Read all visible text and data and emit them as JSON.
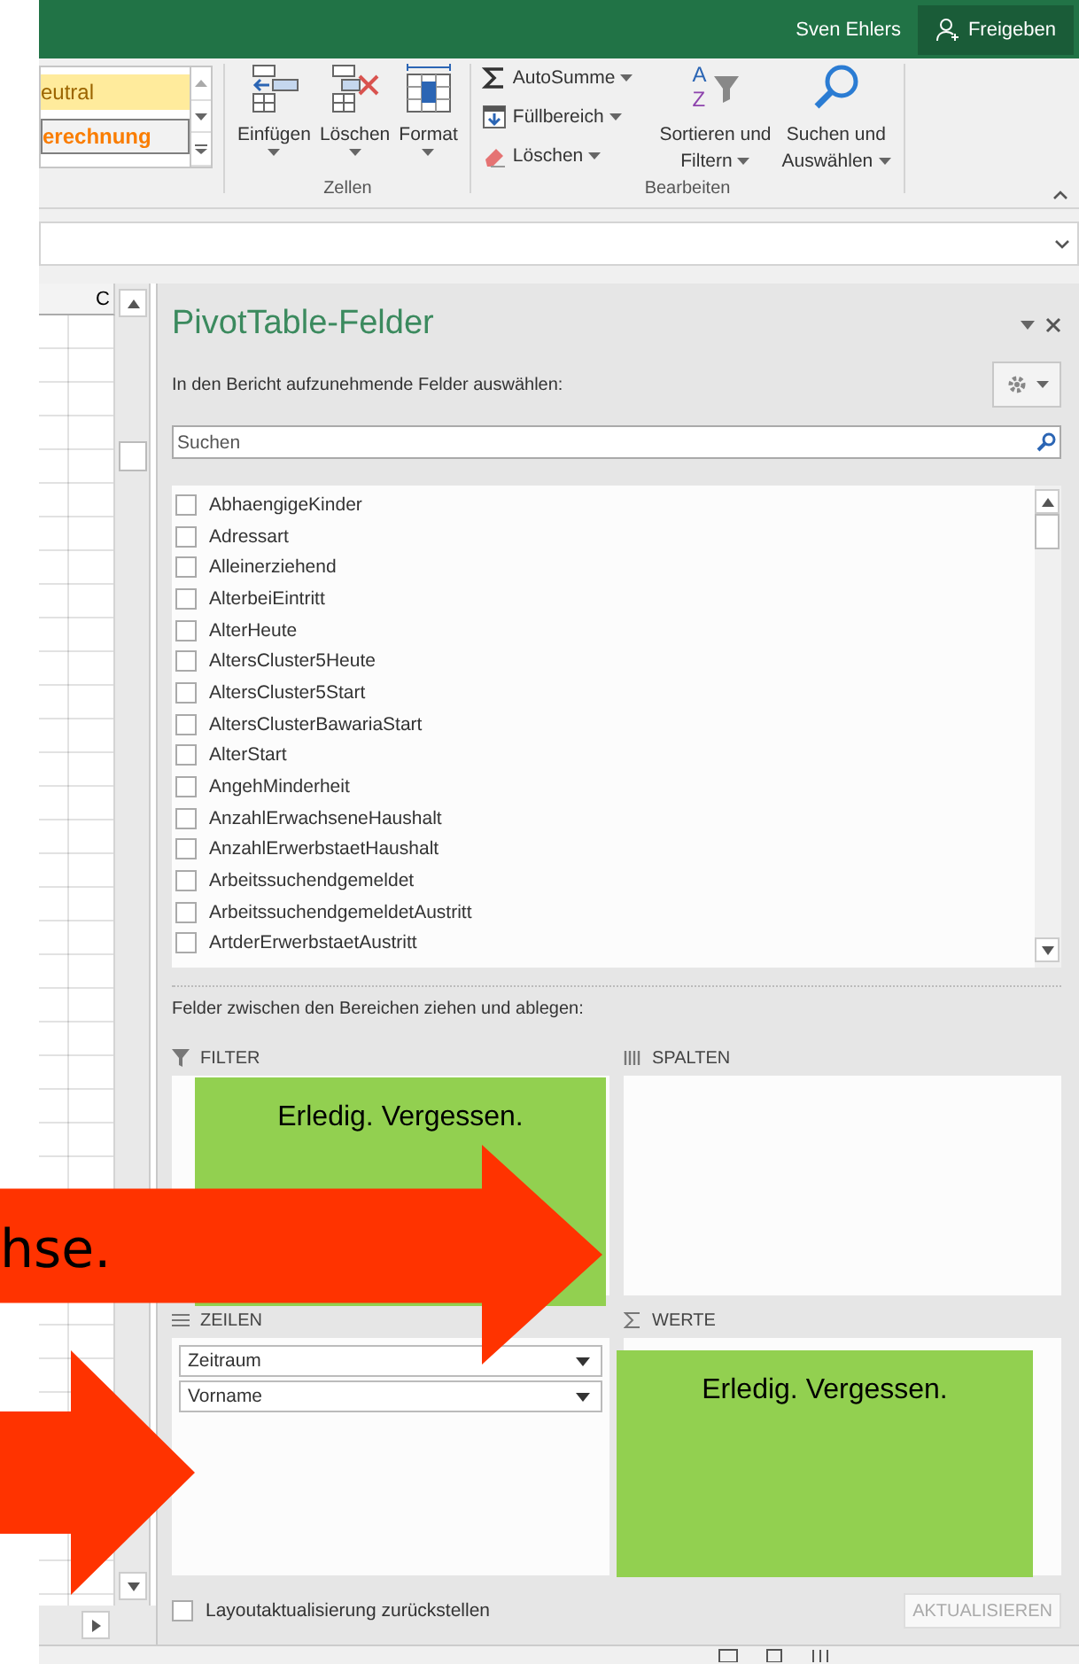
{
  "title_bar": {
    "user": "Sven Ehlers",
    "share_button": "Freigeben"
  },
  "ribbon": {
    "styles": [
      {
        "label": "eutral",
        "kind": "neutral"
      },
      {
        "label": "erechnung",
        "kind": "calc"
      }
    ],
    "cells_group": {
      "label": "Zellen",
      "commands": [
        {
          "label": "Einfügen",
          "kind": "insert"
        },
        {
          "label": "Löschen",
          "kind": "delete"
        },
        {
          "label": "Format",
          "kind": "format"
        }
      ]
    },
    "editing_group": {
      "label": "Bearbeiten",
      "small_commands": [
        {
          "label": "AutoSumme",
          "kind": "sum"
        },
        {
          "label": "Füllbereich",
          "kind": "fill"
        },
        {
          "label": "Löschen",
          "kind": "clear"
        }
      ],
      "commands": [
        {
          "lines": [
            "Sortieren und",
            "Filtern"
          ],
          "kind": "sort",
          "icon_letters": [
            "A",
            "Z"
          ]
        },
        {
          "lines": [
            "Suchen und",
            "Auswählen"
          ],
          "kind": "find"
        }
      ]
    }
  },
  "sheet": {
    "column_header": "C"
  },
  "pivot_pane": {
    "title": "PivotTable-Felder",
    "prompt": "In den Bericht aufzunehmende Felder auswählen:",
    "search": {
      "placeholder": "Suchen"
    },
    "fields": [
      {
        "name": "AbhaengigeKinder",
        "checked": false
      },
      {
        "name": "Adressart",
        "checked": false
      },
      {
        "name": "Alleinerziehend",
        "checked": false
      },
      {
        "name": "AlterbeiEintritt",
        "checked": false
      },
      {
        "name": "AlterHeute",
        "checked": false
      },
      {
        "name": "AltersCluster5Heute",
        "checked": false
      },
      {
        "name": "AltersCluster5Start",
        "checked": false
      },
      {
        "name": "AltersClusterBawariaStart",
        "checked": false
      },
      {
        "name": "AlterStart",
        "checked": false
      },
      {
        "name": "AngehMinderheit",
        "checked": false
      },
      {
        "name": "AnzahlErwachseneHaushalt",
        "checked": false
      },
      {
        "name": "AnzahlErwerbstaetHaushalt",
        "checked": false
      },
      {
        "name": "Arbeitssuchendgemeldet",
        "checked": false
      },
      {
        "name": "ArbeitssuchendgemeldetAustritt",
        "checked": false
      },
      {
        "name": "ArtderErwerbstaetAustritt",
        "checked": false
      }
    ],
    "areas_prompt": "Felder zwischen den Bereichen ziehen und ablegen:",
    "areas": [
      {
        "label": "FILTER",
        "kind": "filter"
      },
      {
        "label": "SPALTEN",
        "kind": "columns"
      },
      {
        "label": "ZEILEN",
        "kind": "rows",
        "items": [
          "Zeitraum",
          "Vorname"
        ]
      },
      {
        "label": "WERTE",
        "kind": "values"
      }
    ],
    "defer": {
      "label": "Layoutaktualisierung zurückstellen",
      "checked": false
    },
    "update_button": "AKTUALISIEREN"
  },
  "annotations": [
    {
      "kind": "note",
      "text": "Erledig. Vergessen."
    },
    {
      "kind": "note",
      "text": "Erledig. Vergessen."
    },
    {
      "kind": "arrow",
      "text": "hse."
    },
    {
      "kind": "arrow"
    }
  ]
}
